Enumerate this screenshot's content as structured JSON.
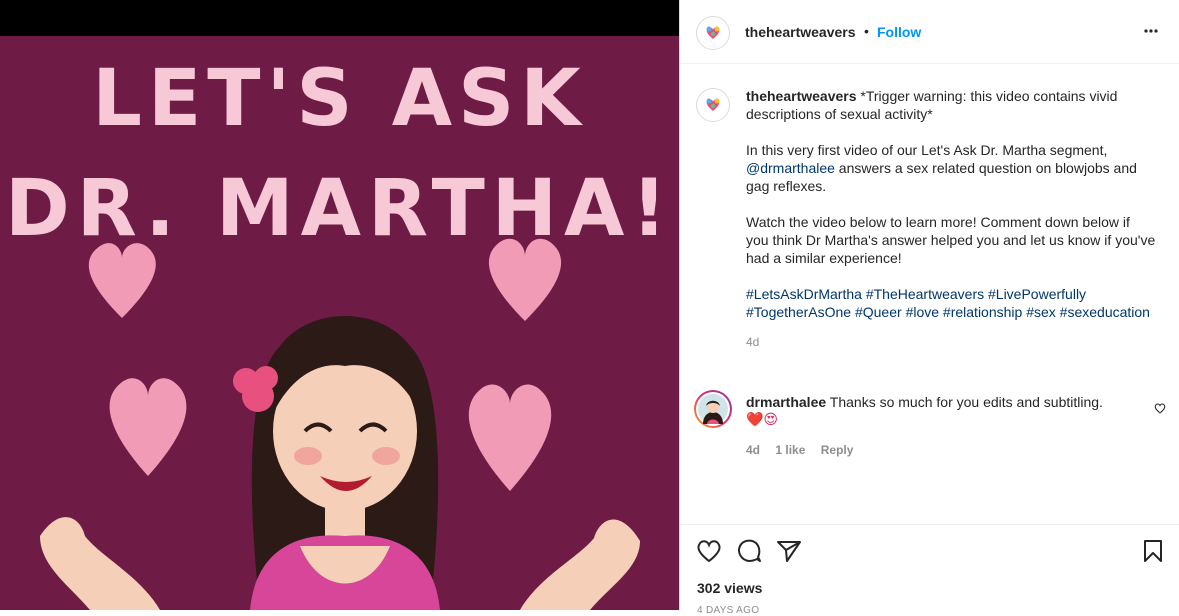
{
  "media": {
    "title_line1": "LET'S ASK",
    "title_line2": "DR. MARTHA!"
  },
  "header": {
    "username": "theheartweavers",
    "dot": "•",
    "follow_label": "Follow",
    "more_icon": "more-horizontal-icon"
  },
  "caption": {
    "username": "theheartweavers",
    "text1": " *Trigger warning: this video contains vivid descriptions of sexual activity*",
    "para2_pre": "In this very first video of our Let's Ask Dr. Martha segment, ",
    "para2_mention": "@drmarthalee",
    "para2_post": " answers a sex related question on blowjobs and gag reflexes.",
    "para3": "Watch the video below to learn more! Comment down below if you think Dr Martha's answer helped you and let us know if you've had a similar experience!",
    "hashtags": [
      "#LetsAskDrMartha",
      "#TheHeartweavers",
      "#LivePowerfully",
      "#TogetherAsOne",
      "#Queer",
      "#love",
      "#relationship",
      "#sex",
      "#sexeducation"
    ],
    "time": "4d"
  },
  "comment": {
    "username": "drmarthalee",
    "text": " Thanks so much for you edits and subtitling.",
    "emoji": "❤️😍",
    "time": "4d",
    "likes": "1 like",
    "reply": "Reply"
  },
  "actions": {
    "like_icon": "heart-icon",
    "comment_icon": "comment-icon",
    "share_icon": "share-icon",
    "save_icon": "bookmark-icon",
    "views": "302 views",
    "posted": "4 DAYS AGO"
  },
  "colors": {
    "video_bg": "#6e1c45",
    "title_pink": "#f7c8d6",
    "follow_blue": "#0095f6",
    "link_blue": "#00376b"
  }
}
